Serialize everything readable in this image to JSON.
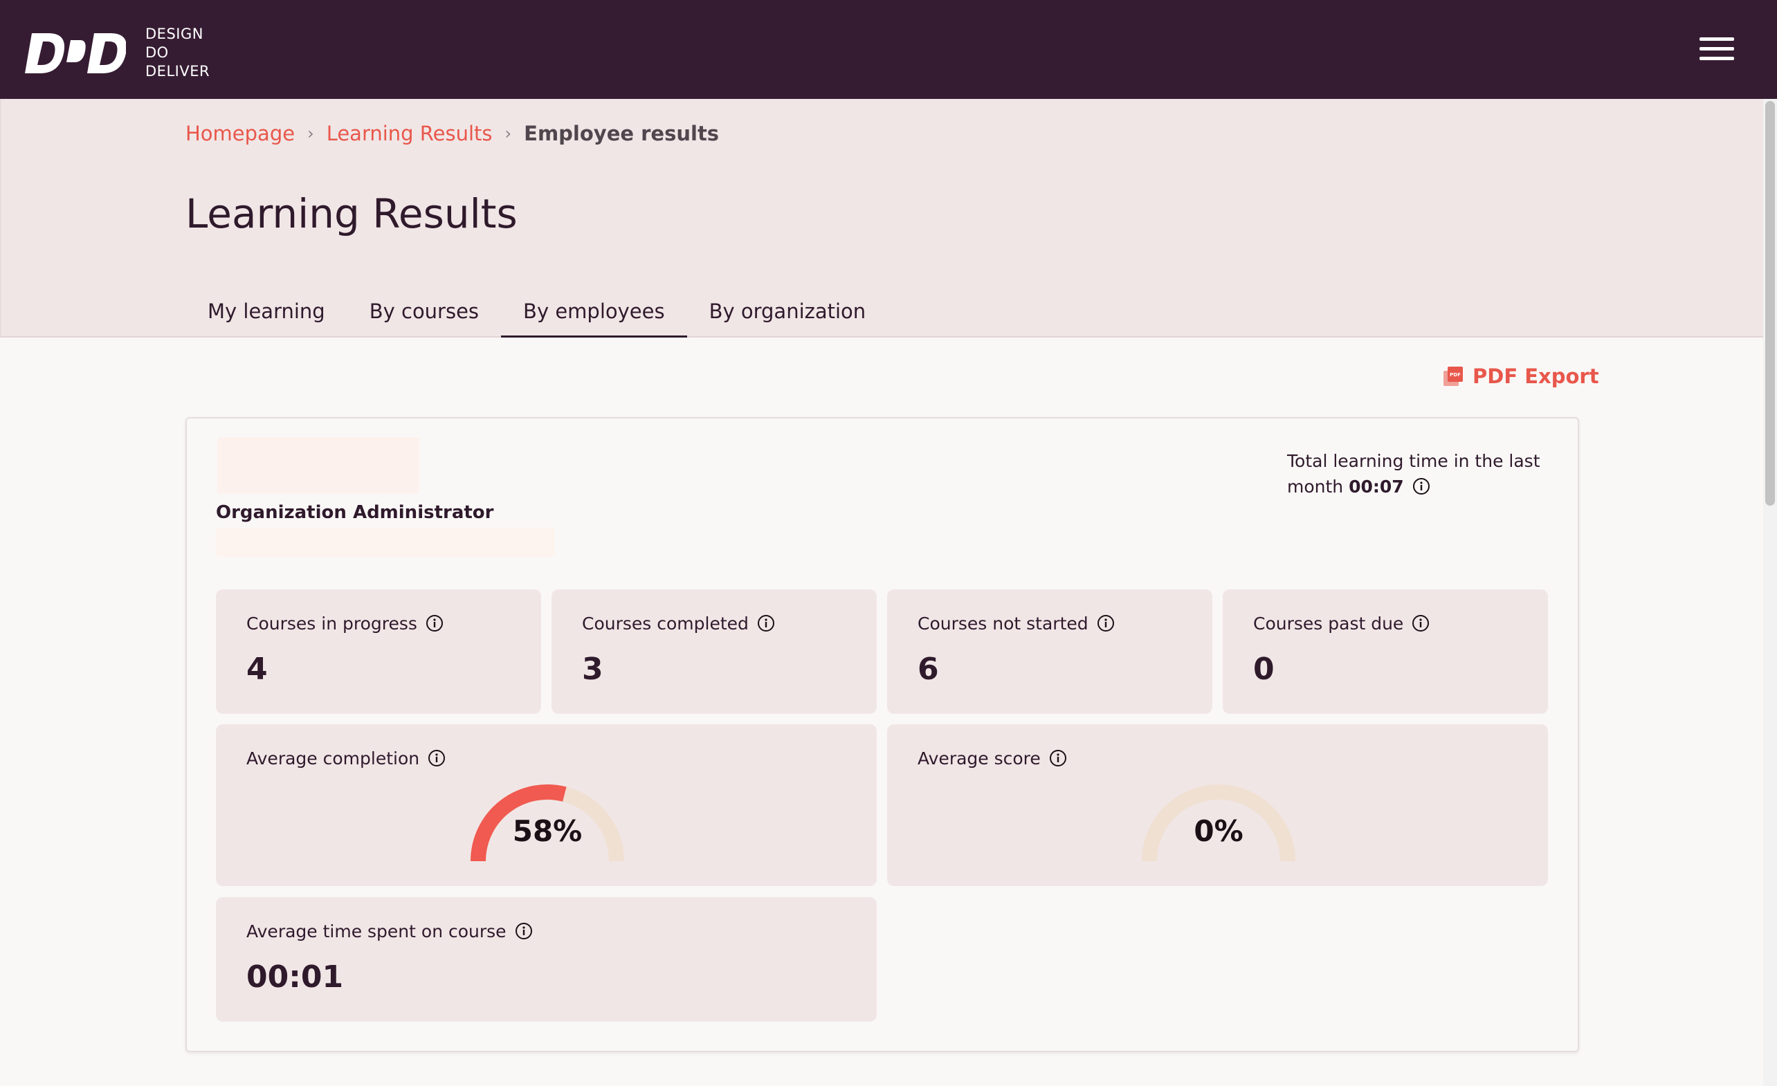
{
  "brand": {
    "logo_mark": "DOD",
    "logo_lines": [
      "DESIGN",
      "DO",
      "DELIVER"
    ]
  },
  "breadcrumb": {
    "items": [
      "Homepage",
      "Learning Results"
    ],
    "current": "Employee results"
  },
  "page_title": "Learning Results",
  "tabs": [
    {
      "label": "My learning",
      "active": false
    },
    {
      "label": "By courses",
      "active": false
    },
    {
      "label": "By employees",
      "active": true
    },
    {
      "label": "By organization",
      "active": false
    }
  ],
  "pdf_export_label": "PDF Export",
  "employee": {
    "role": "Organization Administrator",
    "total_time_label": "Total learning time in the last month",
    "total_time_value": "00:07"
  },
  "stats": [
    {
      "label": "Courses in progress",
      "value": "4"
    },
    {
      "label": "Courses completed",
      "value": "3"
    },
    {
      "label": "Courses not started",
      "value": "6"
    },
    {
      "label": "Courses past due",
      "value": "0"
    }
  ],
  "gauges": [
    {
      "label": "Average completion",
      "value_text": "58%",
      "value": 0.58
    },
    {
      "label": "Average score",
      "value_text": "0%",
      "value": 0.0
    }
  ],
  "avg_time": {
    "label": "Average time spent on course",
    "value": "00:01"
  },
  "colors": {
    "topbar": "#361c33",
    "accent": "#e8574b",
    "gauge_track": "#f0e0d2",
    "card_bg": "#f1e6e6"
  }
}
